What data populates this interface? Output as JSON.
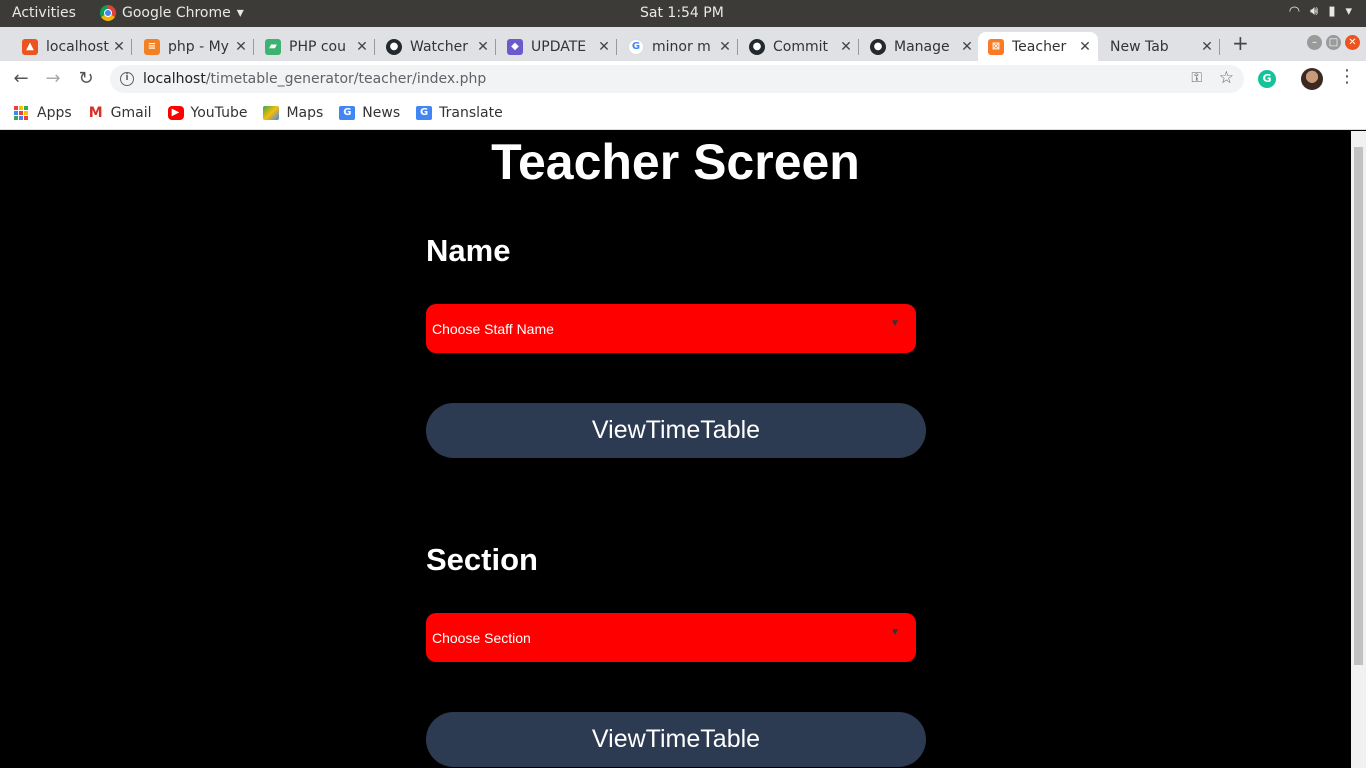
{
  "os_bar": {
    "activities": "Activities",
    "app_name": "Google Chrome",
    "clock": "Sat  1:54 PM"
  },
  "tabs": [
    {
      "label": "localhost",
      "icon": "localhost-icon",
      "color": "#e95420"
    },
    {
      "label": "php - My",
      "icon": "stackoverflow-icon",
      "color": "#f48024"
    },
    {
      "label": "PHP cou",
      "icon": "php-course-icon",
      "color": "#3cb371"
    },
    {
      "label": "Watcher",
      "icon": "github-icon",
      "color": "#24292e"
    },
    {
      "label": "UPDATE",
      "icon": "update-icon",
      "color": "#6a5acd"
    },
    {
      "label": "minor m",
      "icon": "google-icon",
      "color": "#4285f4"
    },
    {
      "label": "Commit",
      "icon": "github-icon",
      "color": "#24292e"
    },
    {
      "label": "Manage",
      "icon": "github-icon",
      "color": "#24292e"
    },
    {
      "label": "Teacher",
      "icon": "xampp-icon",
      "color": "#fb7a24"
    },
    {
      "label": "New Tab",
      "icon": "",
      "color": ""
    }
  ],
  "url": {
    "host": "localhost",
    "path": "/timetable_generator/teacher/index.php"
  },
  "bookmarks": [
    {
      "label": "Apps",
      "icon": "apps-grid-icon"
    },
    {
      "label": "Gmail",
      "icon": "gmail-icon",
      "color": "#d93025"
    },
    {
      "label": "YouTube",
      "icon": "youtube-icon",
      "color": "#ff0000"
    },
    {
      "label": "Maps",
      "icon": "maps-icon",
      "color": "#34a853"
    },
    {
      "label": "News",
      "icon": "news-icon",
      "color": "#4285f4"
    },
    {
      "label": "Translate",
      "icon": "translate-icon",
      "color": "#4285f4"
    }
  ],
  "page": {
    "title": "Teacher Screen",
    "name_section": {
      "label": "Name",
      "select_value": "Choose Staff Name",
      "button": "ViewTimeTable"
    },
    "section_section": {
      "label": "Section",
      "select_value": "Choose Section",
      "button": "ViewTimeTable"
    }
  },
  "colors": {
    "background": "#000000",
    "select_bg": "#ff0000",
    "button_bg": "#2c3a52",
    "text": "#ffffff"
  }
}
